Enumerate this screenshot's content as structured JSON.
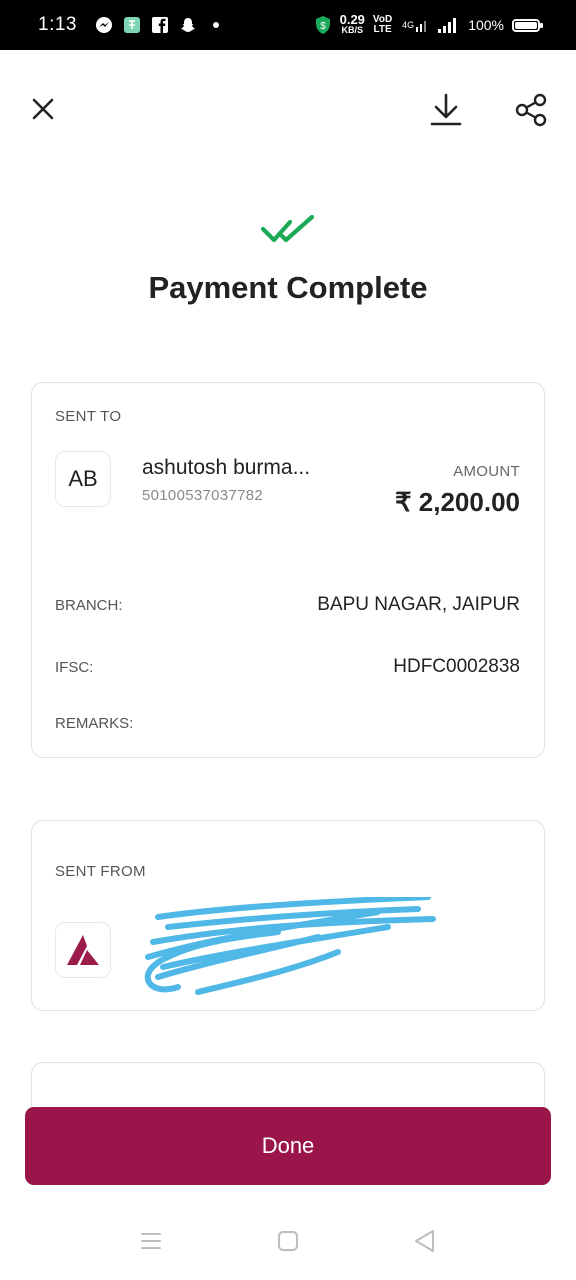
{
  "status_bar": {
    "time": "1:13",
    "net_speed_value": "0.29",
    "net_speed_unit": "KB/S",
    "carrier_top": "VoD",
    "carrier_bottom": "LTE",
    "network_type": "4G",
    "battery": "100%",
    "left_icons": [
      "messenger-icon",
      "app-icon",
      "facebook-icon",
      "snapchat-icon",
      "dot-icon"
    ]
  },
  "header": {
    "close_icon": "close-icon",
    "download_icon": "download-icon",
    "share_icon": "share-icon"
  },
  "title": "Payment Complete",
  "accent_color": "#99154a",
  "success_color": "#1aaa55",
  "sent_to": {
    "label": "SENT TO",
    "avatar_initials": "AB",
    "name": "ashutosh burma...",
    "account": "50100537037782",
    "amount_label": "AMOUNT",
    "amount": "₹ 2,200.00",
    "rows": [
      {
        "label": "BRANCH:",
        "value": "BAPU NAGAR, JAIPUR"
      },
      {
        "label": "IFSC:",
        "value": "HDFC0002838"
      },
      {
        "label": "REMARKS:",
        "value": ""
      }
    ]
  },
  "sent_from": {
    "label": "SENT FROM",
    "bank_logo": "axis-bank-logo"
  },
  "done_button": "Done",
  "nav": {
    "menu_icon": "menu-icon",
    "home_icon": "home-icon",
    "back_icon": "back-icon"
  }
}
